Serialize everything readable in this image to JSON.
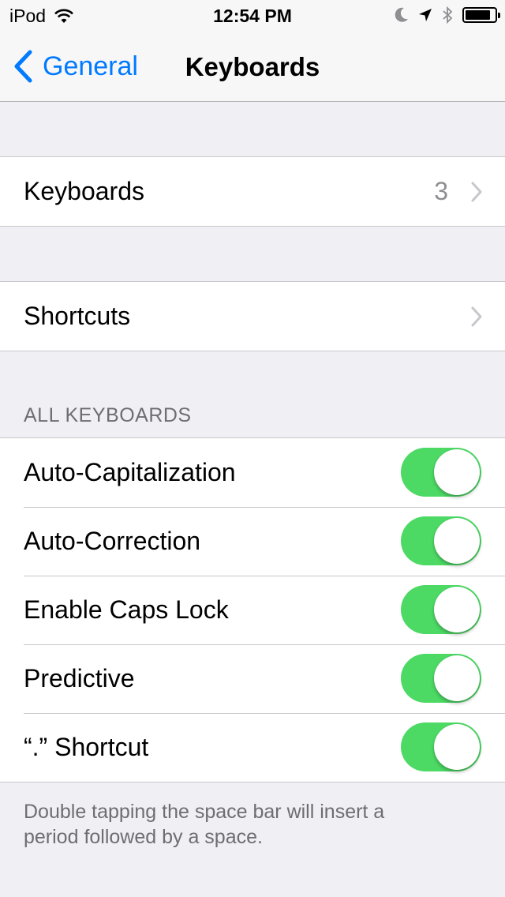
{
  "status_bar": {
    "carrier": "iPod",
    "time": "12:54 PM",
    "icons": [
      "wifi-icon",
      "moon-icon",
      "location-arrow-icon",
      "bluetooth-icon",
      "battery-icon"
    ],
    "battery_level": 0.85
  },
  "nav": {
    "back_label": "General",
    "title": "Keyboards",
    "accent_color": "#007aff"
  },
  "group1": {
    "rows": [
      {
        "label": "Keyboards",
        "value": "3"
      }
    ]
  },
  "group2": {
    "rows": [
      {
        "label": "Shortcuts"
      }
    ]
  },
  "all_keyboards": {
    "header": "ALL KEYBOARDS",
    "toggles": [
      {
        "label": "Auto-Capitalization",
        "on": true
      },
      {
        "label": "Auto-Correction",
        "on": true
      },
      {
        "label": "Enable Caps Lock",
        "on": true
      },
      {
        "label": "Predictive",
        "on": true
      },
      {
        "label": "“.” Shortcut",
        "on": true
      }
    ],
    "footer": "Double tapping the space bar will insert a period followed by a space.",
    "toggle_on_color": "#4cd964"
  }
}
